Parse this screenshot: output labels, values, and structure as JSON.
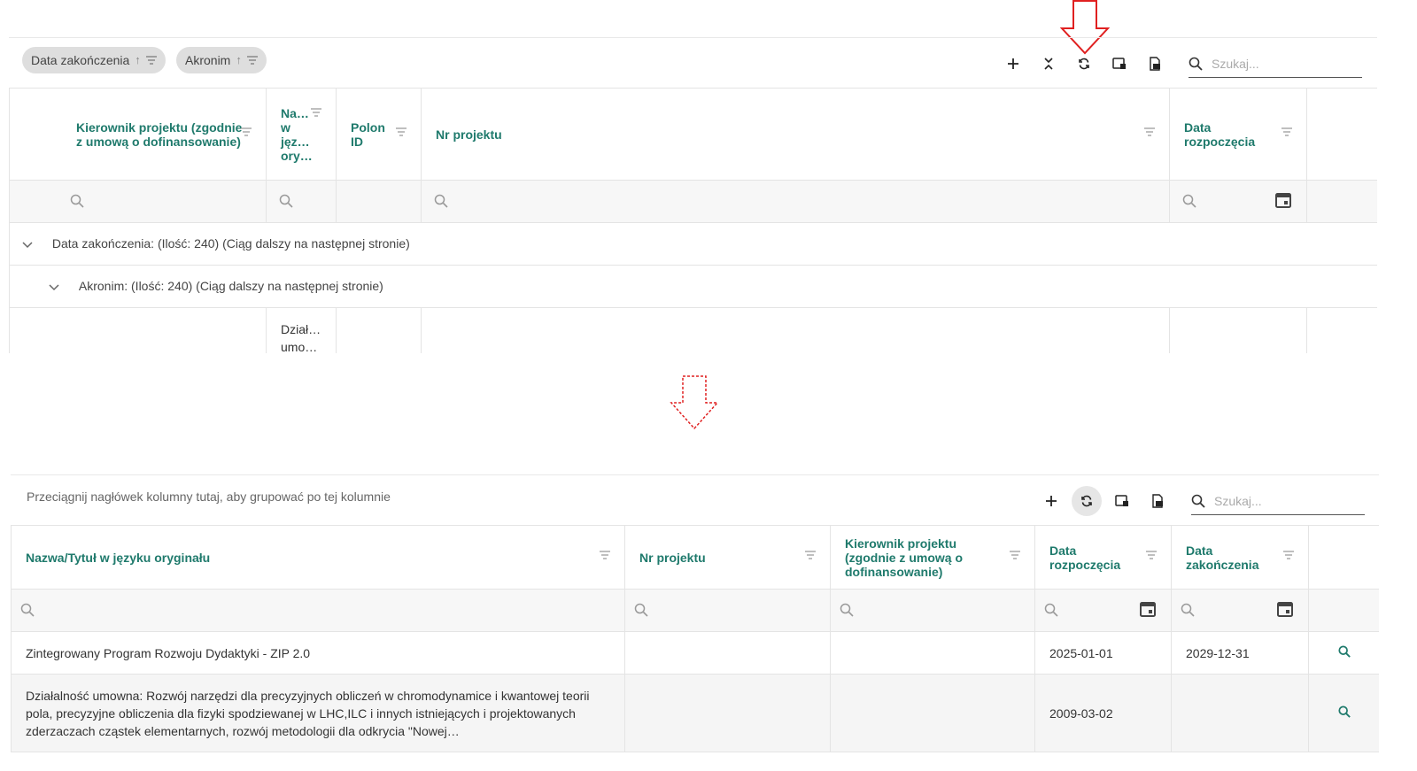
{
  "top": {
    "group_chips": [
      {
        "label": "Data zakończenia"
      },
      {
        "label": "Akronim"
      }
    ],
    "search_placeholder": "Szukaj...",
    "columns": [
      {
        "label": "Kierownik projektu (zgodnie z umową o dofinansowanie)"
      },
      {
        "label": "Na… w jęz… ory…"
      },
      {
        "label": "Polon ID"
      },
      {
        "label": "Nr projektu"
      },
      {
        "label": "Data rozpoczęcia"
      }
    ],
    "group_rows": [
      {
        "label": "Data zakończenia: (Ilość: 240) (Ciąg dalszy na następnej stronie)"
      },
      {
        "label": "Akronim: (Ilość: 240) (Ciąg dalszy na następnej stronie)"
      }
    ],
    "partial_cell": "Dział… umo…"
  },
  "bottom": {
    "group_hint": "Przeciągnij nagłówek kolumny tutaj, aby grupować po tej kolumnie",
    "search_placeholder": "Szukaj...",
    "columns": [
      {
        "label": "Nazwa/Tytuł w języku oryginału"
      },
      {
        "label": "Nr projektu"
      },
      {
        "label": "Kierownik projektu (zgodnie z umową o dofinansowanie)"
      },
      {
        "label": "Data rozpoczęcia"
      },
      {
        "label": "Data zakończenia"
      }
    ],
    "rows": [
      {
        "title": "Zintegrowany Program Rozwoju Dydaktyki - ZIP 2.0",
        "nr": "",
        "kierownik": "",
        "start": "2025-01-01",
        "end": "2029-12-31"
      },
      {
        "title": "Działalność umowna: Rozwój narzędzi dla precyzyjnych obliczeń w chromodynamice i kwantowej teorii pola, precyzyjne obliczenia dla fizyki spodziewanej w LHC,ILC i innych istniejących i projektowanych zderzaczach cząstek elementarnych, rozwój metodologii dla odkrycia \"Nowej…",
        "nr": "",
        "kierownik": "",
        "start": "2009-03-02",
        "end": ""
      }
    ]
  },
  "colors": {
    "accent": "#1f7a6c",
    "arrow": "#e02020"
  }
}
